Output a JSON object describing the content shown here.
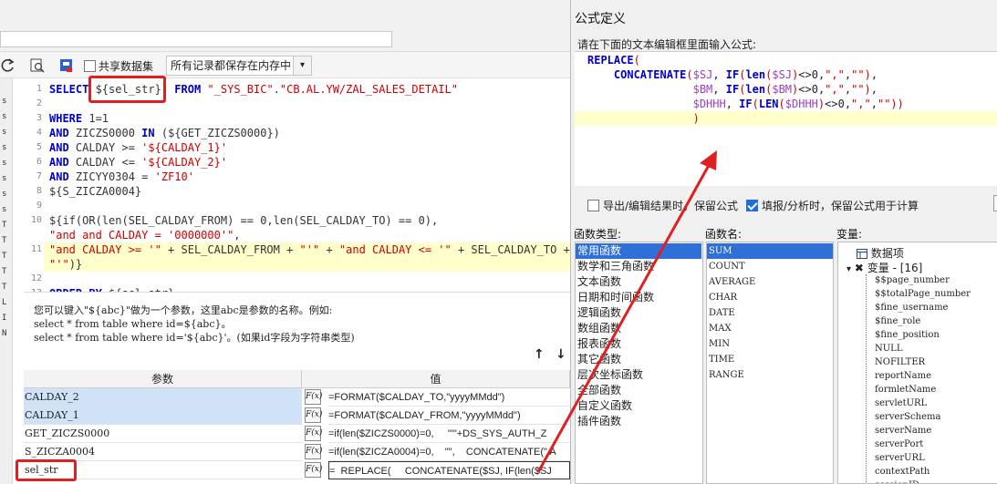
{
  "toolbar": {
    "share_dataset_label": "共享数据集",
    "storage_mode_value": "所有记录都保存在内存中"
  },
  "left_gutter_chars": [
    "s",
    "s",
    "s",
    "s",
    "s",
    "s",
    "s",
    "s",
    "T",
    "T",
    "T",
    "T",
    "T",
    "L",
    "I",
    "N"
  ],
  "sql_editor": {
    "lines": [
      {
        "n": "1",
        "text": "SELECT ${sel_str}  FROM \"_SYS_BIC\".\"CB.AL.YW/ZAL_SALES_DETAIL\""
      },
      {
        "n": "2",
        "text": ""
      },
      {
        "n": "3",
        "text": "WHERE 1=1"
      },
      {
        "n": "4",
        "text": "AND ZICZS0000 IN (${GET_ZICZS0000})"
      },
      {
        "n": "5",
        "text": "AND CALDAY >= '${CALDAY_1}'"
      },
      {
        "n": "6",
        "text": "AND CALDAY <= '${CALDAY_2}'"
      },
      {
        "n": "7",
        "text": "AND ZICYY0304 = 'ZF10'"
      },
      {
        "n": "8",
        "text": "${S_ZICZA0004}"
      },
      {
        "n": "9",
        "text": ""
      },
      {
        "n": "10",
        "text": "${if(OR(len(SEL_CALDAY_FROM) == 0,len(SEL_CALDAY_TO) == 0),"
      },
      {
        "n": "",
        "text": "\"and and CALDAY = '0000000'\","
      },
      {
        "n": "11",
        "text": "\"and CALDAY >= '\" + SEL_CALDAY_FROM + \"'\" + \"and CALDAY <= '\" + SEL_CALDAY_TO +"
      },
      {
        "n": "",
        "text": "\"'\")}"
      },
      {
        "n": "12",
        "text": ""
      },
      {
        "n": "13",
        "text": "ORDER BY ${sel_str}"
      }
    ]
  },
  "hint": {
    "line1": "您可以键入\"${abc}\"做为一个参数，这里abc是参数的名称。例如:",
    "line2": "select * from table where id=${abc}。",
    "line3": "select * from table where id='${abc}'。(如果id字段为字符串类型)"
  },
  "params": {
    "col_name": "参数",
    "col_value": "值",
    "fx_label": "F(x)",
    "rows": [
      {
        "name": "CALDAY_2",
        "value": "=FORMAT($CALDAY_TO,\"yyyyMMdd\")"
      },
      {
        "name": "CALDAY_1",
        "value": "=FORMAT($CALDAY_FROM,\"yyyyMMdd\")"
      },
      {
        "name": "GET_ZICZS0000",
        "value": "=if(len($ZICZS0000)=0,     \"'\"+DS_SYS_AUTH_Z"
      },
      {
        "name": "S_ZICZA0004",
        "value": "=if(len($ZICZA0004)=0,    \"\",    CONCATENATE(\" A"
      },
      {
        "name": "sel_str",
        "value": "=  REPLACE(     CONCATENATE($SJ, IF(len($SJ"
      }
    ]
  },
  "dialog": {
    "title": "公式定义",
    "prompt": "请在下面的文本编辑框里面输入公式:",
    "formula_lines": [
      "REPLACE(",
      "    CONCATENATE($SJ, IF(len($SJ)<>0,\",\",\"\"),",
      "                $BM, IF(len($BM)<>0,\",\",\"\"),",
      "                $DHHH, IF(LEN($DHHH)<>0,\",\",\"\"))",
      "                )"
    ],
    "option_export": "导出/编辑结果时，保留公式",
    "option_fill": "填报/分析时，保留公式用于计算",
    "func_type_label": "函数类型:",
    "func_name_label": "函数名:",
    "var_label": "变量:",
    "func_types": [
      "常用函数",
      "数学和三角函数",
      "文本函数",
      "日期和时间函数",
      "逻辑函数",
      "数组函数",
      "报表函数",
      "其它函数",
      "层次坐标函数",
      "全部函数",
      "自定义函数",
      "插件函数"
    ],
    "func_names": [
      "SUM",
      "COUNT",
      "AVERAGE",
      "CHAR",
      "DATE",
      "MAX",
      "MIN",
      "TIME",
      "RANGE"
    ],
    "tree_root": "数据项",
    "tree_vars": "变量 - [16]",
    "variables": [
      "$$page_number",
      "$$totalPage_number",
      "$fine_username",
      "$fine_role",
      "$fine_position",
      "NULL",
      "NOFILTER",
      "reportName",
      "formletName",
      "servletURL",
      "serverSchema",
      "serverName",
      "serverPort",
      "serverURL",
      "contextPath",
      "sessionID"
    ]
  },
  "colors": {
    "keyword": "#0000cc",
    "string": "#cc0000",
    "variable": "#9b40c0",
    "highlight": "#ffffcc",
    "selection": "#2f6fd9",
    "annotation_red": "#e02020"
  }
}
